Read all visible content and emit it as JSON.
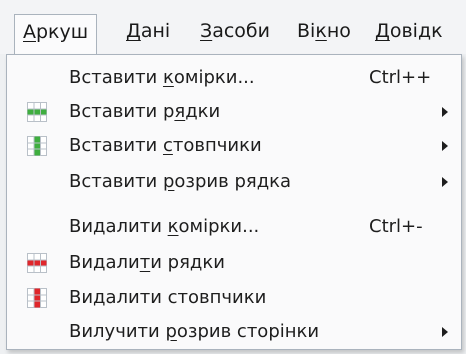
{
  "menubar": {
    "items": [
      {
        "pre": "",
        "ul": "А",
        "post": "ркуш"
      },
      {
        "pre": "",
        "ul": "Д",
        "post": "ані"
      },
      {
        "pre": "",
        "ul": "З",
        "post": "асоби"
      },
      {
        "pre": "Ві",
        "ul": "к",
        "post": "но"
      },
      {
        "pre": "",
        "ul": "Д",
        "post": "овідк"
      }
    ]
  },
  "menu": {
    "items": [
      {
        "pre": "Вставити ",
        "ul": "к",
        "post": "омірки...",
        "shortcut": "Ctrl++",
        "icon": "",
        "submenu": false
      },
      {
        "pre": "Вставити р",
        "ul": "я",
        "post": "дки",
        "shortcut": "",
        "icon": "insert-rows-icon",
        "submenu": true
      },
      {
        "pre": "Вставити ",
        "ul": "с",
        "post": "товпчики",
        "shortcut": "",
        "icon": "insert-columns-icon",
        "submenu": true
      },
      {
        "pre": "Вставити ",
        "ul": "р",
        "post": "озрив рядка",
        "shortcut": "",
        "icon": "",
        "submenu": true
      },
      {
        "pre": "Видалити ",
        "ul": "к",
        "post": "омірки...",
        "shortcut": "Ctrl+-",
        "icon": "",
        "submenu": false
      },
      {
        "pre": "Видали",
        "ul": "т",
        "post": "и рядки",
        "shortcut": "",
        "icon": "delete-rows-icon",
        "submenu": false
      },
      {
        "pre": "Видалити стовпчики",
        "ul": "",
        "post": "",
        "shortcut": "",
        "icon": "delete-columns-icon",
        "submenu": false
      },
      {
        "pre": "Вилучити ",
        "ul": "р",
        "post": "озрив сторінки",
        "shortcut": "",
        "icon": "",
        "submenu": true
      }
    ]
  },
  "colors": {
    "insert_accent": "#3fae3f",
    "delete_accent": "#e0262b"
  }
}
